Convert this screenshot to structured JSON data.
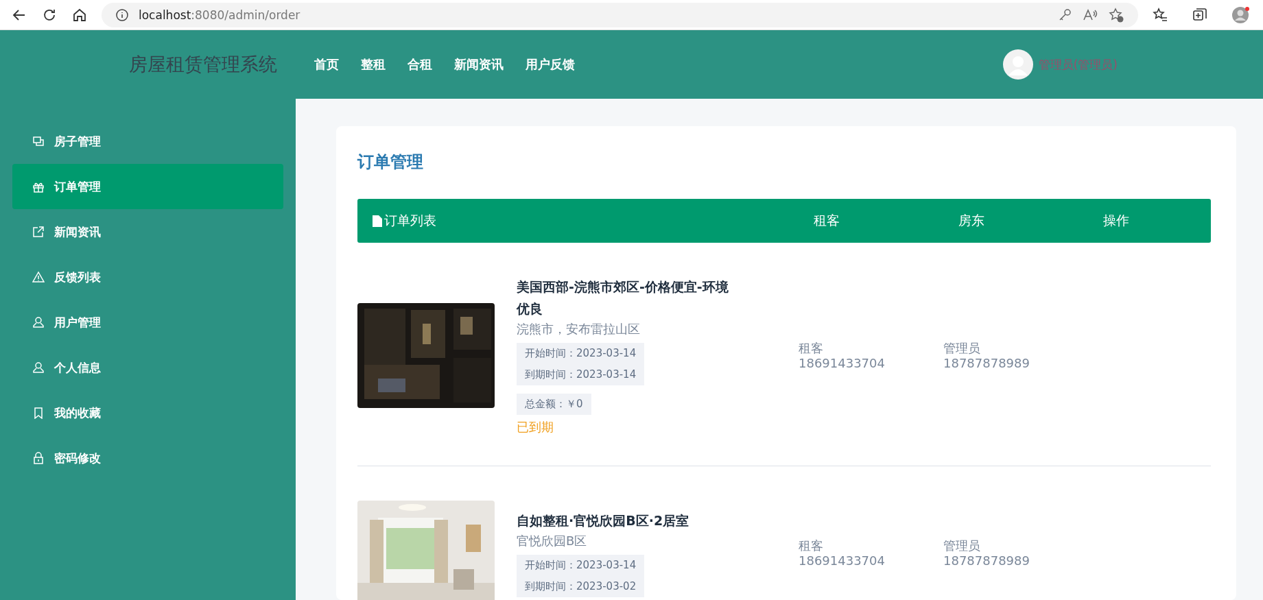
{
  "browser": {
    "url_host": "localhost",
    "url_path": ":8080/admin/order"
  },
  "header": {
    "title": "房屋租赁管理系统",
    "nav": [
      "首页",
      "整租",
      "合租",
      "新闻资讯",
      "用户反馈"
    ],
    "user": "管理员(管理员)"
  },
  "sidebar": {
    "items": [
      {
        "label": "房子管理",
        "selected": false
      },
      {
        "label": "订单管理",
        "selected": true
      },
      {
        "label": "新闻资讯",
        "selected": false
      },
      {
        "label": "反馈列表",
        "selected": false
      },
      {
        "label": "用户管理",
        "selected": false
      },
      {
        "label": "个人信息",
        "selected": false
      },
      {
        "label": "我的收藏",
        "selected": false
      },
      {
        "label": "密码修改",
        "selected": false
      }
    ]
  },
  "page": {
    "title": "订单管理"
  },
  "table": {
    "columns": [
      "订单列表",
      "租客",
      "房东",
      "操作"
    ],
    "rows": [
      {
        "title": "美国西部-浣熊市郊区-价格便宜-环境优良",
        "address": "浣熊市，安布雷拉山区",
        "start": "开始时间：2023-03-14",
        "end": "到期时间：2023-03-14",
        "total": "总金额：￥0",
        "status": "已到期",
        "tenant_label": "租客",
        "tenant_phone": "18691433704",
        "landlord_label": "管理员",
        "landlord_phone": "18787878989"
      },
      {
        "title": "自如整租·官悦欣园B区·2居室",
        "address": "官悦欣园B区",
        "start": "开始时间：2023-03-14",
        "end": "到期时间：2023-03-02",
        "tenant_label": "租客",
        "tenant_phone": "18691433704",
        "landlord_label": "管理员",
        "landlord_phone": "18787878989"
      }
    ]
  }
}
